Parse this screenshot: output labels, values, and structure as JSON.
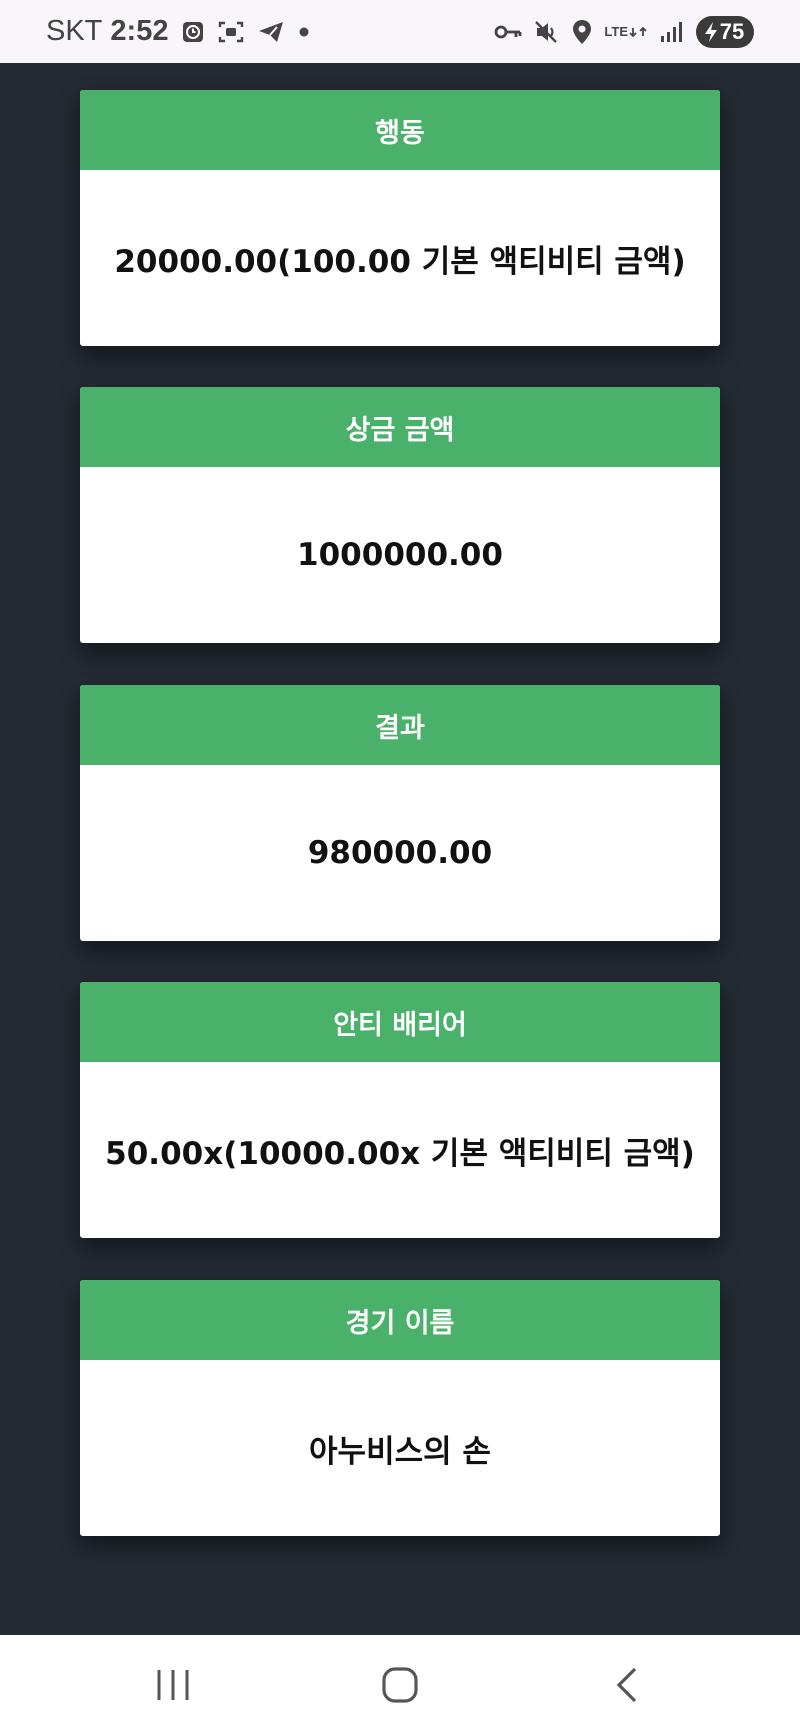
{
  "status_bar": {
    "carrier": "SKT",
    "time": "2:52",
    "network": "LTE",
    "battery": "75",
    "left_icons": [
      "alarm-icon",
      "screenshot-icon",
      "telegram-icon",
      "notification-dot-icon"
    ],
    "right_icons": [
      "vpn-key-icon",
      "mute-icon",
      "location-icon",
      "lte-icon",
      "signal-icon",
      "battery-icon"
    ]
  },
  "cards": [
    {
      "title": "행동",
      "value": "20000.00(100.00 기본 액티비티 금액)"
    },
    {
      "title": "상금 금액",
      "value": "1000000.00"
    },
    {
      "title": "결과",
      "value": "980000.00"
    },
    {
      "title": "안티 배리어",
      "value": "50.00x(10000.00x 기본 액티비티 금액)"
    },
    {
      "title": "경기 이름",
      "value": "아누비스의 손"
    }
  ],
  "nav_bar": {
    "icons": [
      "recent-apps-icon",
      "home-icon",
      "back-icon"
    ]
  },
  "colors": {
    "background": "#232a33",
    "card_header": "#4ab16b",
    "card_body": "#ffffff",
    "status_bar": "#f8f5fb"
  }
}
